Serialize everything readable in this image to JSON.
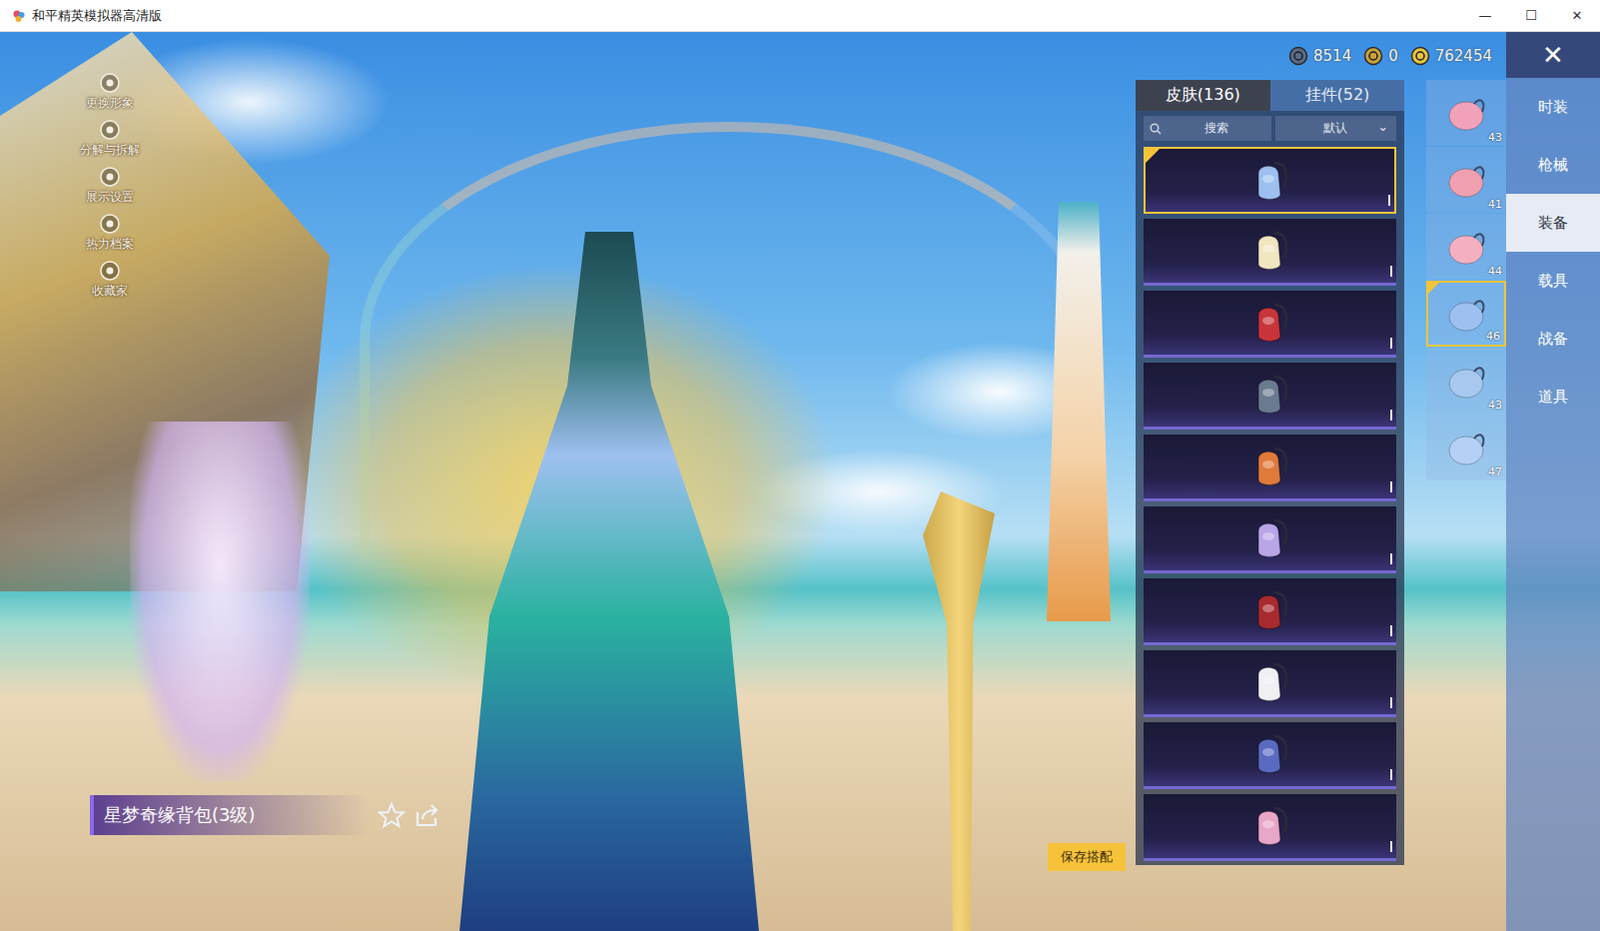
{
  "window": {
    "title": "和平精英模拟器高清版",
    "controls": [
      "—",
      "☐",
      "✕"
    ]
  },
  "side_menu": [
    {
      "label": "更换形象"
    },
    {
      "label": "分解与拆解"
    },
    {
      "label": "展示设置"
    },
    {
      "label": "热力档案"
    },
    {
      "label": "收藏家"
    }
  ],
  "currencies": [
    {
      "amount": "8514",
      "color": "#5a6a8a"
    },
    {
      "amount": "0",
      "color": "#c9a23a"
    },
    {
      "amount": "762454",
      "color": "#e8c440"
    }
  ],
  "close": "✕",
  "tabs": [
    {
      "label": "皮肤(136)",
      "selected": true
    },
    {
      "label": "挂件(52)",
      "selected": false
    }
  ],
  "search": {
    "placeholder": "搜索"
  },
  "sort": {
    "value": "默认",
    "arrow": "⌄"
  },
  "items": [
    {
      "selected": true,
      "color": "#9ec0f0"
    },
    {
      "selected": false,
      "color": "#f2e6c0"
    },
    {
      "selected": false,
      "color": "#c8343a"
    },
    {
      "selected": false,
      "color": "#6a7a90"
    },
    {
      "selected": false,
      "color": "#e07a3a"
    },
    {
      "selected": false,
      "color": "#b8a6e8"
    },
    {
      "selected": false,
      "color": "#a82a2e"
    },
    {
      "selected": false,
      "color": "#f0f0f4"
    },
    {
      "selected": false,
      "color": "#5a6ac0"
    },
    {
      "selected": false,
      "color": "#e8a6c8"
    }
  ],
  "variants": [
    {
      "level": "43",
      "selected": false,
      "color": "#f2a2b8"
    },
    {
      "level": "41",
      "selected": false,
      "color": "#f0a0b0"
    },
    {
      "level": "44",
      "selected": false,
      "color": "#f4b0c0"
    },
    {
      "level": "46",
      "selected": true,
      "color": "#9ec0f0"
    },
    {
      "level": "43",
      "selected": false,
      "color": "#a8c8f0"
    },
    {
      "level": "47",
      "selected": false,
      "color": "#b4d0f4"
    }
  ],
  "categories": [
    {
      "label": "时装",
      "selected": false
    },
    {
      "label": "枪械",
      "selected": false
    },
    {
      "label": "装备",
      "selected": true
    },
    {
      "label": "载具",
      "selected": false
    },
    {
      "label": "战备",
      "selected": false
    },
    {
      "label": "道具",
      "selected": false
    }
  ],
  "selected_item": {
    "name": "星梦奇缘背包(3级)"
  },
  "save_button": "保存搭配"
}
